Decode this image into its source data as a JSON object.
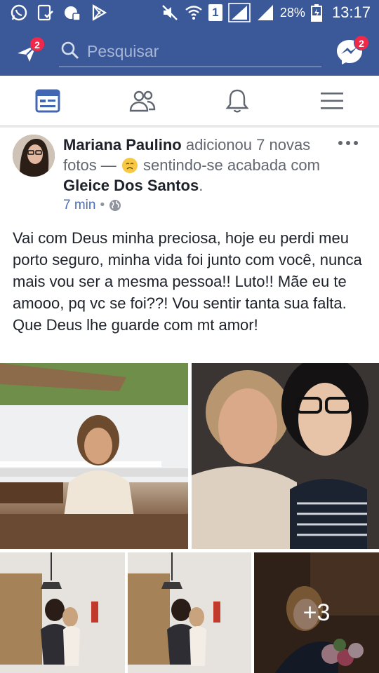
{
  "status_bar": {
    "battery_percent": "28%",
    "time": "13:17",
    "sim_label": "1"
  },
  "top_bar": {
    "notifications_badge": "2",
    "search_placeholder": "Pesquisar",
    "messenger_badge": "2"
  },
  "nav": {
    "items": [
      {
        "name": "news-feed",
        "active": true
      },
      {
        "name": "friends",
        "active": false
      },
      {
        "name": "notifications",
        "active": false
      },
      {
        "name": "menu",
        "active": false
      }
    ]
  },
  "post": {
    "author": "Mariana Paulino",
    "action_text": " adicionou 7 novas fotos — ",
    "feeling_text": " sentindo-se acabada com ",
    "tagged": "Gleice Dos Santos",
    "tagged_suffix": ".",
    "time": "7 min",
    "separator": "•",
    "body": "Vai com Deus minha preciosa, hoje eu perdi meu porto seguro, minha vida foi junto com você, nunca mais vou ser a mesma pessoa!! Luto!! Mãe eu te amooo, pq vc se foi??! Vou sentir tanta sua falta. Que Deus lhe guarde com mt amor!",
    "more_photos_label": "+3"
  },
  "colors": {
    "brand": "#3b5998",
    "badge": "#f02849",
    "link": "#4b6bb7"
  }
}
